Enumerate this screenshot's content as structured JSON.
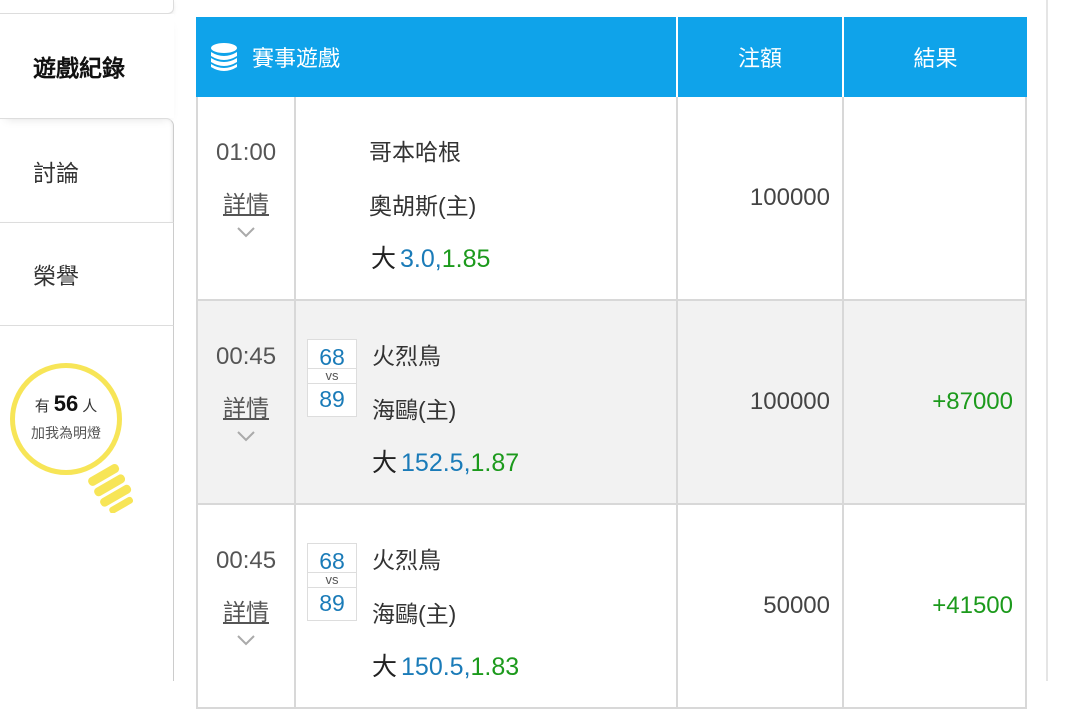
{
  "sidebar": {
    "items": [
      {
        "label": "遊戲紀錄"
      },
      {
        "label": "討論"
      },
      {
        "label": "榮譽"
      }
    ],
    "bulb": {
      "prefix": "有",
      "count": "56",
      "suffix": "人",
      "caption": "加我為明燈"
    }
  },
  "table": {
    "headers": {
      "game": "賽事遊戲",
      "amount": "注額",
      "result": "結果"
    },
    "rows": [
      {
        "time": "01:00",
        "detail": "詳情",
        "score_home": "",
        "score_vs": "",
        "score_away": "",
        "team1": "哥本哈根",
        "team2": "奧胡斯(主)",
        "bet_type": "大",
        "bet_line": "3.0",
        "bet_sep": ",",
        "bet_odds": "1.85",
        "amount": "100000",
        "result": ""
      },
      {
        "time": "00:45",
        "detail": "詳情",
        "score_home": "68",
        "score_vs": "vs",
        "score_away": "89",
        "team1": "火烈鳥",
        "team2": "海鷗(主)",
        "bet_type": "大",
        "bet_line": "152.5",
        "bet_sep": ",",
        "bet_odds": "1.87",
        "amount": "100000",
        "result": "+87000"
      },
      {
        "time": "00:45",
        "detail": "詳情",
        "score_home": "68",
        "score_vs": "vs",
        "score_away": "89",
        "team1": "火烈鳥",
        "team2": "海鷗(主)",
        "bet_type": "大",
        "bet_line": "150.5",
        "bet_sep": ",",
        "bet_odds": "1.83",
        "amount": "50000",
        "result": "+41500"
      }
    ]
  },
  "colors": {
    "header_bg": "#0fa3ea",
    "win": "#1c9a1c",
    "line": "#1a7bb8",
    "bulb": "#f7e557"
  },
  "icons": {
    "header": "coin-stack-icon",
    "expand": "chevron-down-icon",
    "bulb": "lightbulb-icon"
  }
}
